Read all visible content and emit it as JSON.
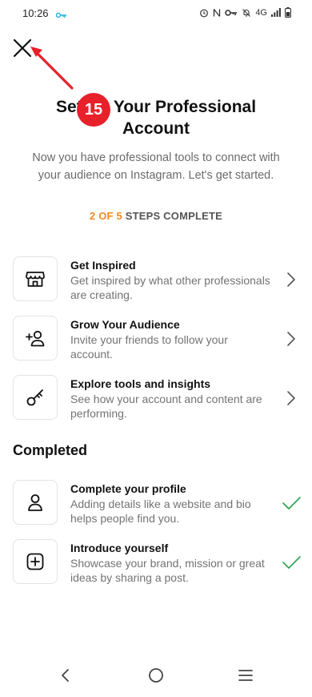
{
  "status_bar": {
    "time": "10:26",
    "network": "4G",
    "icons": [
      "key-icon",
      "alarm-icon",
      "nfc-icon",
      "key-icon",
      "mute-icon",
      "signal-icon",
      "battery-icon"
    ]
  },
  "annotation": {
    "badge": "15",
    "color": "#e8202a"
  },
  "header": {
    "title": "Set Up Your Professional Account",
    "subtitle": "Now you have professional tools to connect with your audience on Instagram. Let's get started."
  },
  "progress": {
    "count": "2 OF 5",
    "label": "STEPS COMPLETE",
    "completed": 2,
    "total": 5,
    "accent": "#f08a24"
  },
  "steps": [
    {
      "title": "Get Inspired",
      "description": "Get inspired by what other professionals are creating.",
      "icon": "shop-icon",
      "status": "chevron"
    },
    {
      "title": "Grow Your Audience",
      "description": "Invite your friends to follow your account.",
      "icon": "add-user-icon",
      "status": "chevron"
    },
    {
      "title": "Explore tools and insights",
      "description": "See how your account and content are performing.",
      "icon": "key-icon",
      "status": "chevron"
    }
  ],
  "completed_section": {
    "heading": "Completed",
    "items": [
      {
        "title": "Complete your profile",
        "description": "Adding details like a website and bio helps people find you.",
        "icon": "user-icon",
        "status": "check"
      },
      {
        "title": "Introduce yourself",
        "description": "Showcase your brand, mission or great ideas by sharing a post.",
        "icon": "add-post-icon",
        "status": "check"
      }
    ],
    "check_color": "#2aa44f"
  },
  "nav": {
    "back": "back-icon",
    "home": "home-icon",
    "recents": "menu-icon"
  }
}
